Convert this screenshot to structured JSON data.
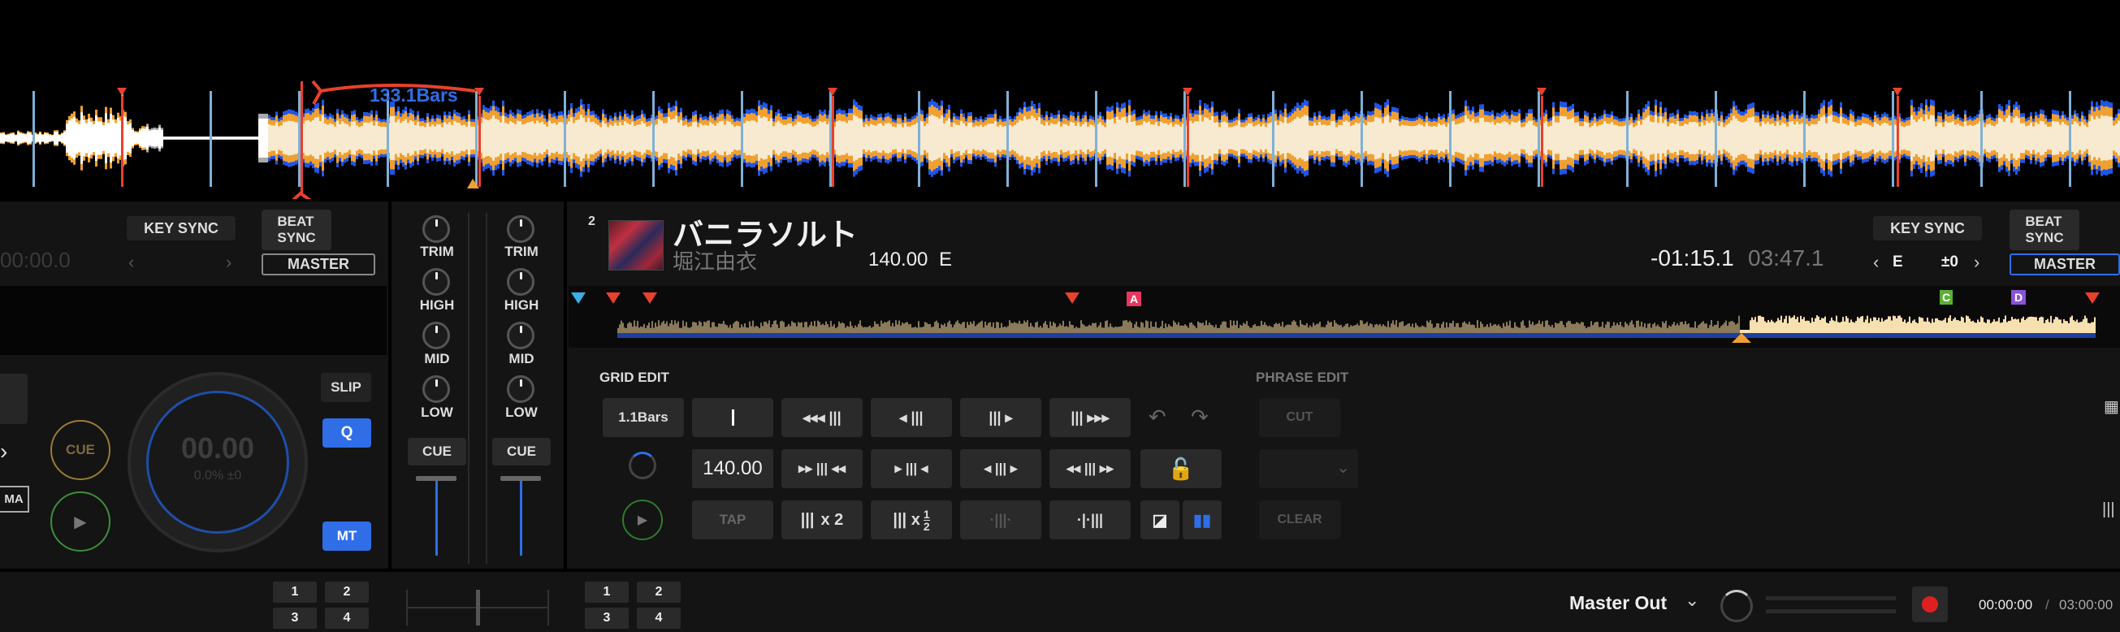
{
  "annotation": {
    "bars_label": "133.1Bars"
  },
  "left_deck": {
    "time": "00:00.0",
    "key_sync": "KEY SYNC",
    "beat_sync": "BEAT\nSYNC",
    "master": "MASTER",
    "cue": "CUE",
    "play_icon": "play-icon",
    "jog_time": "00.00",
    "jog_pitch": "0.0% ±0",
    "slip": "SLIP",
    "q": "Q",
    "mt": "MT",
    "side_ma": "MA",
    "hotcues": [
      "1",
      "2",
      "3",
      "4"
    ]
  },
  "mixer": {
    "trim": "TRIM",
    "high": "HIGH",
    "mid": "MID",
    "low": "LOW",
    "cue": "CUE"
  },
  "right_deck": {
    "deck_number": "2",
    "title": "バニラソルト",
    "artist": "堀江由衣",
    "bpm": "140.00",
    "key": "E",
    "remaining": "-01:15.1",
    "total": "03:47.1",
    "key_sync": "KEY SYNC",
    "key_value": "E",
    "key_shift": "±0",
    "beat_sync": "BEAT\nSYNC",
    "master": "MASTER",
    "hotcue_markers": [
      "A",
      "C",
      "D"
    ],
    "hotcues": [
      "1",
      "2",
      "3",
      "4"
    ]
  },
  "grid_edit": {
    "title": "GRID EDIT",
    "bars": "1.1Bars",
    "bpm_value": "140.00",
    "tap": "TAP",
    "x2": "x 2",
    "x_half_num": "1",
    "x_half_den": "2"
  },
  "phrase_edit": {
    "title": "PHRASE EDIT",
    "cut": "CUT",
    "clear": "CLEAR"
  },
  "bottom": {
    "master_out": "Master Out",
    "rec_time": "00:00:00",
    "rec_sep": "/",
    "rec_total": "03:00:00"
  },
  "colors": {
    "accent": "#2f6ee6",
    "cue_red": "#e8412c",
    "wave_orange": "#f0a030",
    "wave_blue": "#1e55e6",
    "wave_cream": "#f7ead0"
  }
}
